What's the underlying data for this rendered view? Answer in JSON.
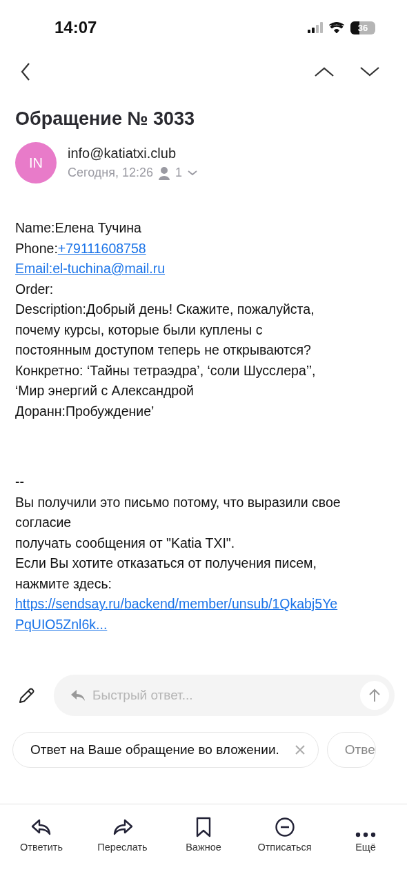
{
  "status_bar": {
    "time": "14:07",
    "battery": {
      "text": "36",
      "level": 0.36
    }
  },
  "subject": "Обращение № 3033",
  "sender": {
    "initials": "IN",
    "color": "#e87bc9",
    "address": "info@katiatxi.club",
    "date": "Сегодня, 12:26",
    "recipients": "1"
  },
  "body": [
    {
      "text": "Name:Елена Тучина"
    },
    {
      "text": "Phone:",
      "link": "+79111608758"
    },
    {
      "link": "Email:el-tuchina@mail.ru"
    },
    {
      "text": "Order:"
    },
    {
      "text": "Description:Добрый день! Скажите, пожалуйста,"
    },
    {
      "text": "почему курсы, которые были куплены с"
    },
    {
      "text": "постоянным доступом теперь не открываются?"
    },
    {
      "text": "Конкретно: ‘Тайны тетраэдра’, ‘соли Шусслера’’,"
    },
    {
      "text": "‘Мир энергий с Александрой"
    },
    {
      "text": "Доранн:Пробуждение’"
    }
  ],
  "footer": [
    {
      "text": "--"
    },
    {
      "text": "Вы получили это письмо потому, что выразили свое"
    },
    {
      "text": "согласие"
    },
    {
      "text": "получать сообщения от \"Katia TXI\"."
    },
    {
      "text": "Если Вы хотите отказаться от получения писем,"
    },
    {
      "text": "нажмите здесь:"
    },
    {
      "link": "https://sendsay.ru/backend/member/unsub/1Qkabj5Ye"
    },
    {
      "link": "PqUIO5Znl6k..."
    }
  ],
  "quick_reply": {
    "placeholder": "Быстрый ответ..."
  },
  "suggestions": [
    {
      "text": "Ответ на Ваше обращение во вложении.",
      "closable": true
    },
    {
      "text": "Отве",
      "closable": false
    }
  ],
  "actions": [
    {
      "kind": "reply",
      "label": "Ответить"
    },
    {
      "kind": "forward",
      "label": "Переслать"
    },
    {
      "kind": "bookmark",
      "label": "Важное"
    },
    {
      "kind": "unsubscribe",
      "label": "Отписаться"
    },
    {
      "kind": "more",
      "label": "Ещё"
    }
  ]
}
